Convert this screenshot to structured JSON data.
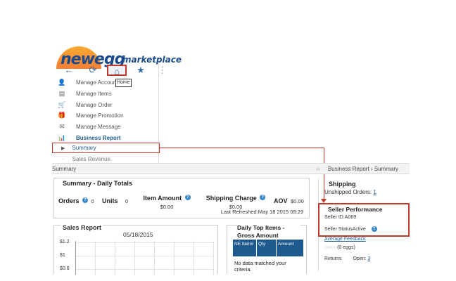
{
  "logo": {
    "main": "newegg",
    "suffix": "marketplace"
  },
  "toolbar": {
    "back_icon": "←",
    "refresh_icon": "⟳",
    "home_icon": "⌂",
    "star_icon": "★",
    "more_icon": "⋮",
    "tooltip": "Home"
  },
  "sidebar": {
    "items": [
      {
        "label": "Manage Account",
        "icon": "👤"
      },
      {
        "label": "Manage Items",
        "icon": "▤"
      },
      {
        "label": "Manage Order",
        "icon": "🛒"
      },
      {
        "label": "Manage Promotion",
        "icon": "🎁"
      },
      {
        "label": "Manage Message",
        "icon": "✉"
      },
      {
        "label": "Business Report",
        "icon": "📊"
      }
    ],
    "summary_label": "Summary",
    "sales_revenue_label": "Sales Revenue"
  },
  "breadcrumb": {
    "page_title": "Summary",
    "path": "Business Report  ›  Summary"
  },
  "summary": {
    "title": "Summary - Daily Totals",
    "orders_label": "Orders",
    "orders_value": "0",
    "units_label": "Units",
    "units_value": "0",
    "item_amount_label": "Item Amount",
    "item_amount_value": "$0.00",
    "shipping_charge_label": "Shipping Charge",
    "shipping_charge_value": "$0.00",
    "aov_label": "AOV",
    "aov_value": "$0.00",
    "last_refreshed": "Last Refreshed:May 18 2015 09:29"
  },
  "shipping": {
    "title": "Shipping",
    "unshipped_label": "Unshipped Orders:",
    "unshipped_value": "1"
  },
  "seller_performance": {
    "title": "Seller Performance",
    "seller_id": "Seller ID:A069",
    "seller_status": "Seller StatusActive",
    "average_feedback_label": "Average Feedback",
    "eggs_text": "(0 eggs)",
    "returns_label": "Returns",
    "open_label": "Open:",
    "open_value": "3"
  },
  "sales_report": {
    "title": "Sales Report",
    "date": "05/18/2015",
    "y_ticks": [
      "$1.2",
      "$1",
      "$0.8"
    ]
  },
  "top_items": {
    "title": "Daily Top Items - Gross Amount",
    "columns": [
      "NE Item#",
      "Qty",
      "Amount"
    ],
    "no_data": "No data matched your criteria."
  }
}
